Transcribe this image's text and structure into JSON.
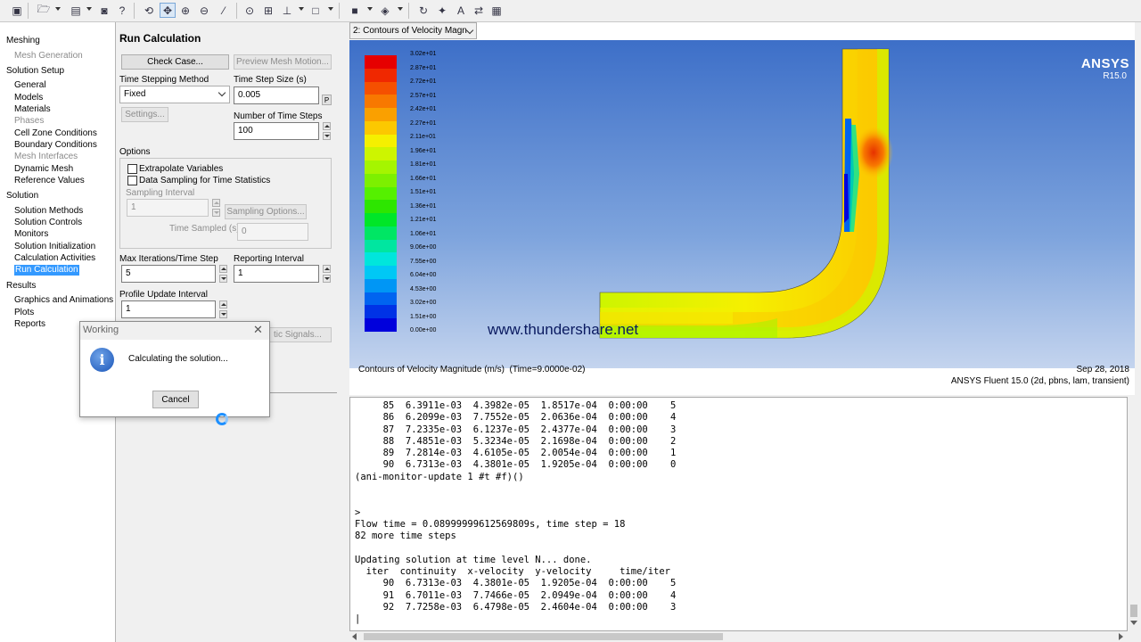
{
  "tree": {
    "items": [
      {
        "label": "Meshing",
        "level": 0,
        "disabled": false
      },
      {
        "label": "Mesh Generation",
        "level": 1,
        "disabled": true
      },
      {
        "label": "Solution Setup",
        "level": 0,
        "disabled": false
      },
      {
        "label": "General",
        "level": 1,
        "disabled": false
      },
      {
        "label": "Models",
        "level": 1,
        "disabled": false
      },
      {
        "label": "Materials",
        "level": 1,
        "disabled": false
      },
      {
        "label": "Phases",
        "level": 1,
        "disabled": true
      },
      {
        "label": "Cell Zone Conditions",
        "level": 1,
        "disabled": false
      },
      {
        "label": "Boundary Conditions",
        "level": 1,
        "disabled": false
      },
      {
        "label": "Mesh Interfaces",
        "level": 1,
        "disabled": true
      },
      {
        "label": "Dynamic Mesh",
        "level": 1,
        "disabled": false
      },
      {
        "label": "Reference Values",
        "level": 1,
        "disabled": false
      },
      {
        "label": "Solution",
        "level": 0,
        "disabled": false
      },
      {
        "label": "Solution Methods",
        "level": 1,
        "disabled": false
      },
      {
        "label": "Solution Controls",
        "level": 1,
        "disabled": false
      },
      {
        "label": "Monitors",
        "level": 1,
        "disabled": false
      },
      {
        "label": "Solution Initialization",
        "level": 1,
        "disabled": false
      },
      {
        "label": "Calculation Activities",
        "level": 1,
        "disabled": false
      },
      {
        "label": "Run Calculation",
        "level": 1,
        "disabled": false,
        "selected": true
      },
      {
        "label": "Results",
        "level": 0,
        "disabled": false
      },
      {
        "label": "Graphics and Animations",
        "level": 1,
        "disabled": false
      },
      {
        "label": "Plots",
        "level": 1,
        "disabled": false
      },
      {
        "label": "Reports",
        "level": 1,
        "disabled": false
      }
    ]
  },
  "panel": {
    "title": "Run Calculation",
    "check_case": "Check Case...",
    "preview_mesh": "Preview Mesh Motion...",
    "time_stepping_label": "Time Stepping Method",
    "time_stepping_value": "Fixed",
    "time_step_size_label": "Time Step Size (s)",
    "time_step_size_value": "0.005",
    "time_step_p": "P",
    "settings": "Settings...",
    "num_steps_label": "Number of Time Steps",
    "num_steps_value": "100",
    "options_label": "Options",
    "extrapolate": "Extrapolate Variables",
    "data_sampling": "Data Sampling for Time Statistics",
    "sampling_interval_label": "Sampling Interval",
    "sampling_interval_value": "1",
    "sampling_options": "Sampling Options...",
    "time_sampled_label": "Time Sampled (s)",
    "time_sampled_value": "0",
    "max_iter_label": "Max Iterations/Time Step",
    "max_iter_value": "5",
    "reporting_label": "Reporting Interval",
    "reporting_value": "1",
    "profile_label": "Profile Update Interval",
    "profile_value": "1",
    "acoustic_signals": "tic Signals..."
  },
  "dialog": {
    "title": "Working",
    "message": "Calculating the solution...",
    "cancel": "Cancel"
  },
  "graphics": {
    "tab_label": "2: Contours of Velocity Magn",
    "brand": "ANSYS",
    "version": "R15.0",
    "watermark": "www.thundershare.net",
    "caption": "Contours of Velocity Magnitude (m/s)  (Time=9.0000e-02)",
    "date": "Sep 28, 2018",
    "solver": "ANSYS Fluent 15.0 (2d, pbns, lam, transient)",
    "colorbar_labels": [
      "3.02e+01",
      "2.87e+01",
      "2.72e+01",
      "2.57e+01",
      "2.42e+01",
      "2.27e+01",
      "2.11e+01",
      "1.96e+01",
      "1.81e+01",
      "1.66e+01",
      "1.51e+01",
      "1.36e+01",
      "1.21e+01",
      "1.06e+01",
      "9.06e+00",
      "7.55e+00",
      "6.04e+00",
      "4.53e+00",
      "3.02e+00",
      "1.51e+00",
      "0.00e+00"
    ],
    "colorbar_colors": [
      "#e60000",
      "#f02800",
      "#f55000",
      "#f87800",
      "#faa000",
      "#fcc800",
      "#f5f000",
      "#cdf500",
      "#a5f500",
      "#7df000",
      "#55f000",
      "#2de600",
      "#00e628",
      "#00e664",
      "#00e6a0",
      "#00e6dc",
      "#00c8f5",
      "#0096f5",
      "#0064f0",
      "#0032e6",
      "#0000dc"
    ]
  },
  "console": {
    "lines": [
      "     85  6.3911e-03  4.3982e-05  1.8517e-04  0:00:00    5",
      "     86  6.2099e-03  7.7552e-05  2.0636e-04  0:00:00    4",
      "     87  7.2335e-03  6.1237e-05  2.4377e-04  0:00:00    3",
      "     88  7.4851e-03  5.3234e-05  2.1698e-04  0:00:00    2",
      "     89  7.2814e-03  4.6105e-05  2.0054e-04  0:00:00    1",
      "     90  6.7313e-03  4.3801e-05  1.9205e-04  0:00:00    0",
      "(ani-monitor-update 1 #t #f)()",
      "",
      "",
      ">",
      "Flow time = 0.08999999612569809s, time step = 18",
      "82 more time steps",
      "",
      "Updating solution at time level N... done.",
      "  iter  continuity  x-velocity  y-velocity     time/iter",
      "     90  6.7313e-03  4.3801e-05  1.9205e-04  0:00:00    5",
      "     91  6.7011e-03  7.7466e-05  2.0949e-04  0:00:00    4",
      "     92  7.7258e-03  6.4798e-05  2.4604e-04  0:00:00    3",
      "|"
    ]
  }
}
